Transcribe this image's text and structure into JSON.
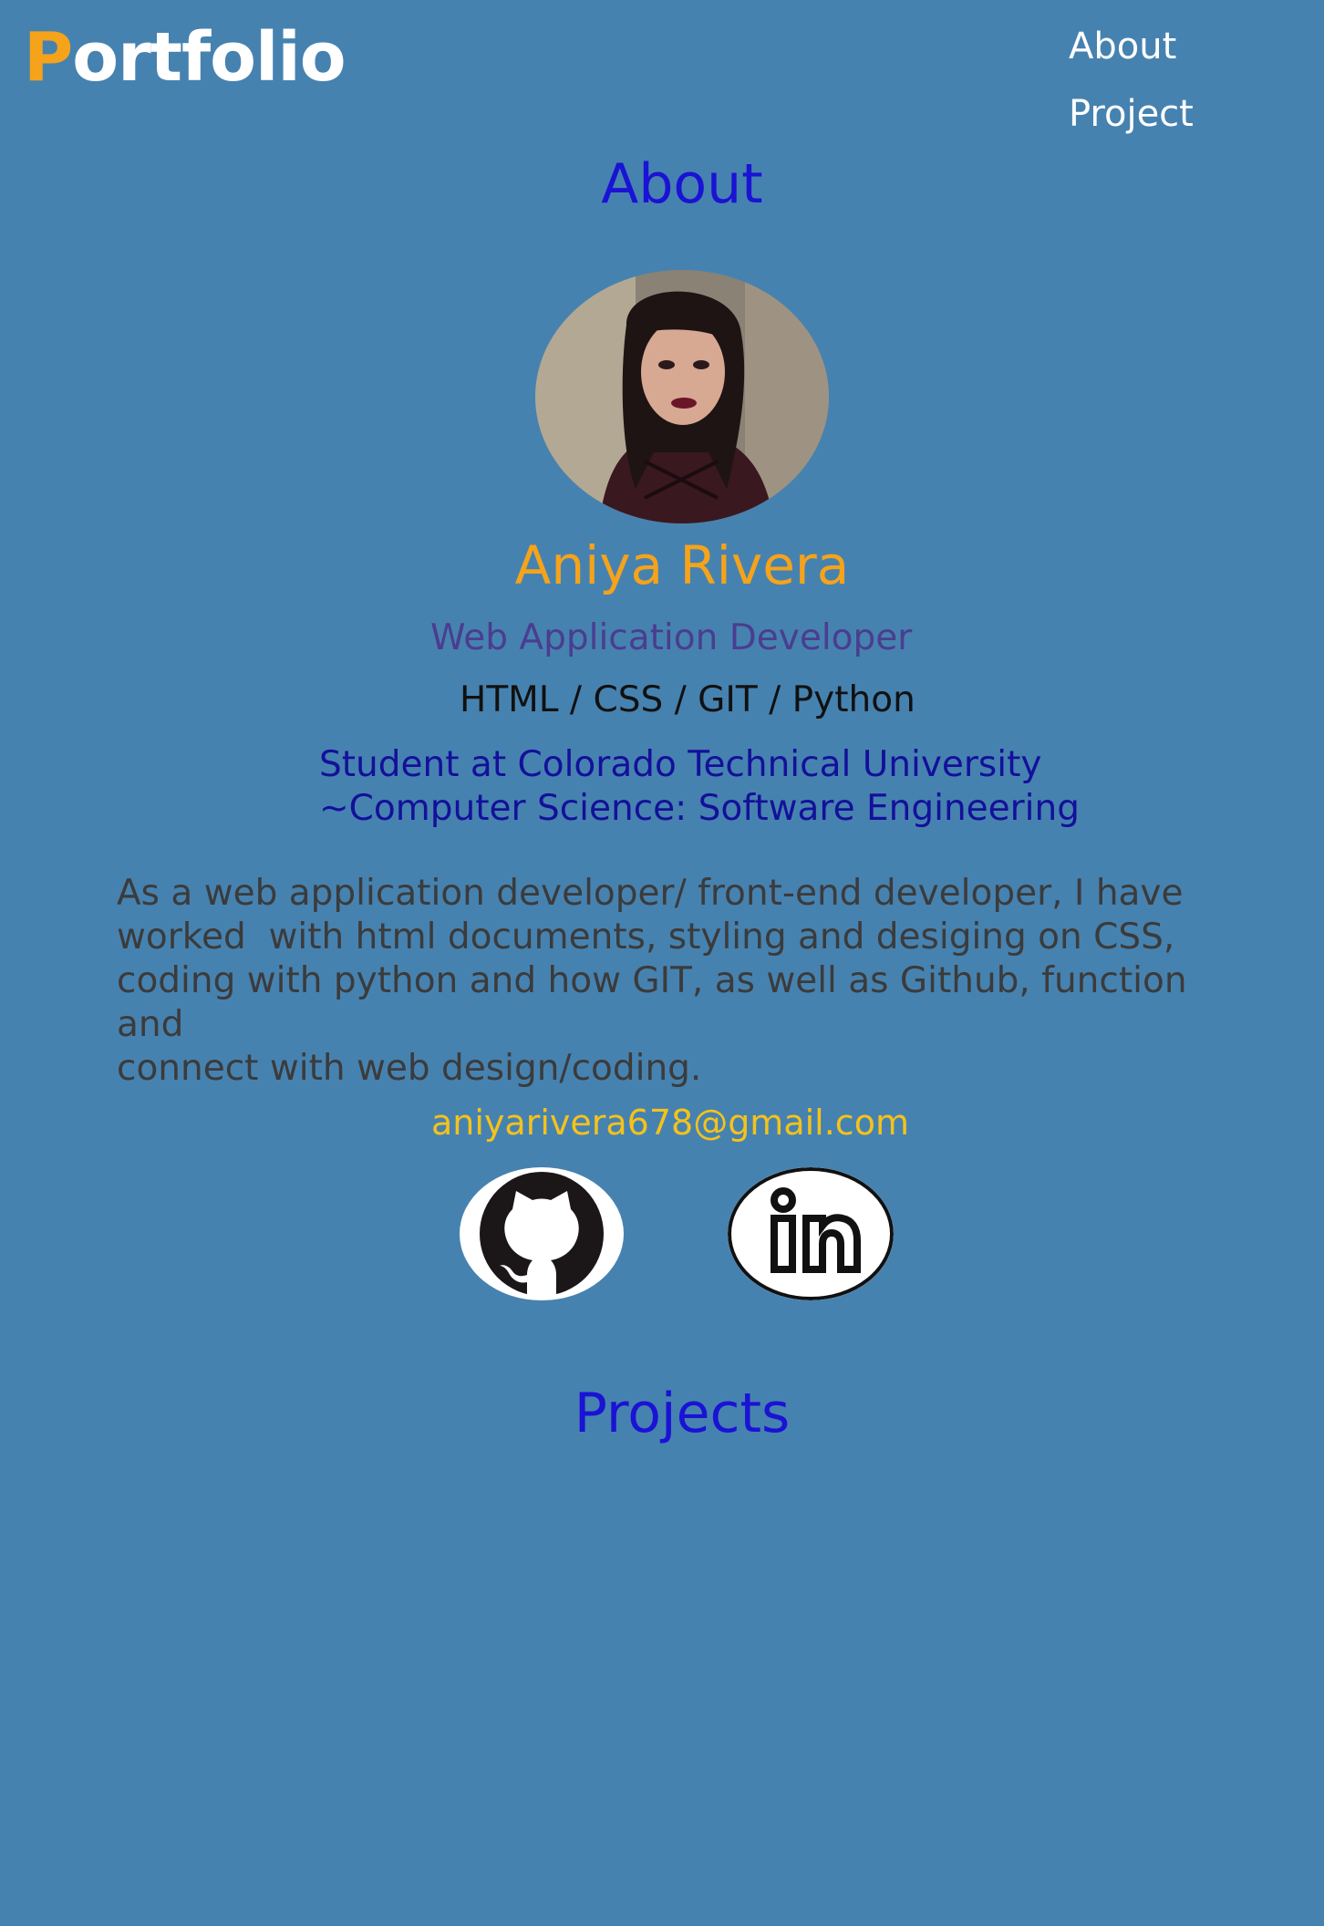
{
  "header": {
    "logo_first": "P",
    "logo_rest": "ortfolio",
    "nav": [
      "About",
      "Project"
    ]
  },
  "about": {
    "title": "About",
    "name": "Aniya Rivera",
    "role": "Web Application Developer",
    "skills": "HTML / CSS / GIT / Python",
    "school_line1": "Student at Colorado Technical University",
    "school_line2": "~Computer Science: Software Engineering",
    "bio": "As a web application developer/ front-end developer, I have\nworked  with html documents, styling and desiging on CSS,\ncoding with python and how GIT, as well as Github, function and\nconnect with web design/coding.",
    "email": "aniyarivera678@gmail.com"
  },
  "social": {
    "github_icon": "github-icon",
    "linkedin_icon": "linkedin-icon"
  },
  "projects": {
    "title": "Projects"
  },
  "colors": {
    "background": "#4682b0",
    "accent": "#f5a31a",
    "heading": "#1a12d4"
  }
}
